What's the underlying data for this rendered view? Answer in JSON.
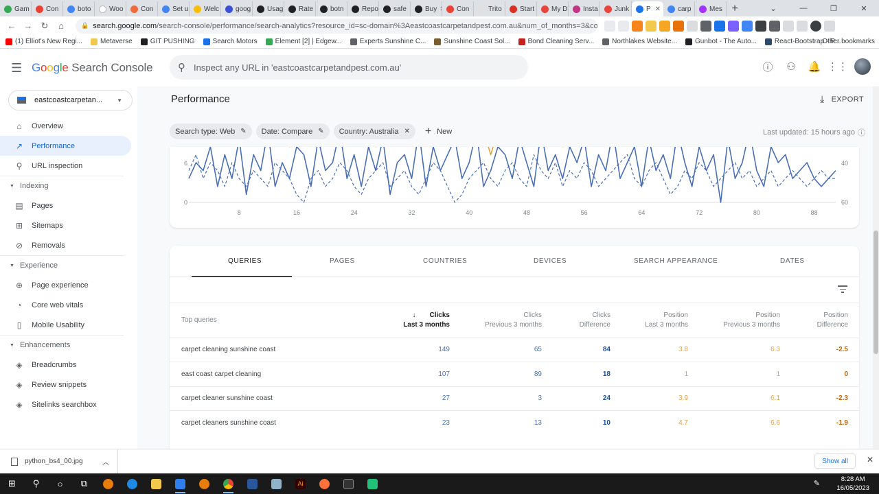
{
  "browser": {
    "tabs": [
      {
        "label": "Gam",
        "color": "#34a853"
      },
      {
        "label": "Con",
        "color": "#ea4335"
      },
      {
        "label": "boto",
        "color": "#4285f4"
      },
      {
        "label": "Woo",
        "color": "#ffffff"
      },
      {
        "label": "Con",
        "color": "#f06b3b"
      },
      {
        "label": "Set u",
        "color": "#4285f4"
      },
      {
        "label": "Welc",
        "color": "#fbbc05"
      },
      {
        "label": "goog",
        "color": "#3c4fd8"
      },
      {
        "label": "Usag",
        "color": "#202124"
      },
      {
        "label": "Rate",
        "color": "#202124"
      },
      {
        "label": "botn",
        "color": "#202124"
      },
      {
        "label": "Repo",
        "color": "#202124"
      },
      {
        "label": "safe",
        "color": "#202124"
      },
      {
        "label": "Buy",
        "color": "#202124"
      },
      {
        "label": "Con",
        "color": "#ea4335"
      },
      {
        "label": "Trito",
        "color": "#e0e0e0"
      },
      {
        "label": "Start",
        "color": "#d93025"
      },
      {
        "label": "My D",
        "color": "#e8453c"
      },
      {
        "label": "Insta",
        "color": "#c13584"
      },
      {
        "label": "Junk",
        "color": "#e8453c"
      },
      {
        "label": "P",
        "color": "#1a73e8",
        "active": true
      },
      {
        "label": "carp",
        "color": "#4285f4"
      },
      {
        "label": "Mes",
        "color": "#a033ff"
      }
    ],
    "url_host": "search.google.com",
    "url_path": "/search-console/performance/search-analytics?resource_id=sc-domain%3Aeastcoastcarpetandpest.com.au&num_of_months=3&compare_da...",
    "bookmarks": [
      {
        "label": "(1) Elliot's New Regi...",
        "color": "#ff0000"
      },
      {
        "label": "Metaverse",
        "color": "#f2c94c"
      },
      {
        "label": "GIT PUSHING",
        "color": "#202124"
      },
      {
        "label": "Search Motors",
        "color": "#1a73e8"
      },
      {
        "label": "Element [2] | Edgew...",
        "color": "#34a853"
      },
      {
        "label": "Experts Sunshine C...",
        "color": "#5f6368"
      },
      {
        "label": "Sunshine Coast Sol...",
        "color": "#7a5c2e"
      },
      {
        "label": "Bond Cleaning Serv...",
        "color": "#c5221f"
      },
      {
        "label": "Northlakes Website...",
        "color": "#5f6368"
      },
      {
        "label": "Gunbot - The Auto...",
        "color": "#202124"
      },
      {
        "label": "React-Bootstrap - R...",
        "color": "#2d4a6b"
      }
    ],
    "other_bookmarks": "Other bookmarks"
  },
  "header": {
    "logo_google": [
      "G",
      "o",
      "o",
      "g",
      "l",
      "e"
    ],
    "logo_product": "Search Console",
    "search_placeholder": "Inspect any URL in 'eastcoastcarpetandpest.com.au'"
  },
  "sidebar": {
    "property": "eastcoastcarpetan...",
    "items": [
      {
        "label": "Overview",
        "icon": "home-icon",
        "glyph": "⌂"
      },
      {
        "label": "Performance",
        "icon": "trending-icon",
        "glyph": "↗",
        "active": true
      },
      {
        "label": "URL inspection",
        "icon": "search-icon",
        "glyph": "⚲"
      }
    ],
    "sections": [
      {
        "title": "Indexing",
        "items": [
          {
            "label": "Pages",
            "icon": "pages-icon",
            "glyph": "▤"
          },
          {
            "label": "Sitemaps",
            "icon": "sitemap-icon",
            "glyph": "⊞"
          },
          {
            "label": "Removals",
            "icon": "removals-icon",
            "glyph": "⊘"
          }
        ]
      },
      {
        "title": "Experience",
        "items": [
          {
            "label": "Page experience",
            "icon": "plus-circle-icon",
            "glyph": "⊕"
          },
          {
            "label": "Core web vitals",
            "icon": "gauge-icon",
            "glyph": "◔"
          },
          {
            "label": "Mobile Usability",
            "icon": "phone-icon",
            "glyph": "▯"
          }
        ]
      },
      {
        "title": "Enhancements",
        "items": [
          {
            "label": "Breadcrumbs",
            "icon": "layers-icon",
            "glyph": "◈"
          },
          {
            "label": "Review snippets",
            "icon": "layers-icon",
            "glyph": "◈"
          },
          {
            "label": "Sitelinks searchbox",
            "icon": "layers-icon",
            "glyph": "◈"
          }
        ]
      }
    ]
  },
  "main": {
    "title": "Performance",
    "export_label": "EXPORT",
    "chips": [
      {
        "label": "Search type: Web",
        "action": "edit"
      },
      {
        "label": "Date: Compare",
        "action": "edit"
      },
      {
        "label": "Country: Australia",
        "action": "close"
      }
    ],
    "new_label": "New",
    "last_updated": "Last updated: 15 hours ago"
  },
  "chart_data": {
    "type": "line",
    "x_ticks": [
      8,
      16,
      24,
      32,
      40,
      48,
      56,
      64,
      72,
      80,
      88
    ],
    "y_left_ticks": [
      0,
      6
    ],
    "y_right_ticks": [
      60,
      40
    ],
    "y_right_inverted": true,
    "colors": {
      "clicks": "#4a6fb5",
      "position": "#e8a33d"
    },
    "series": [
      {
        "style": "solid",
        "color": "#4a6fb5",
        "values": [
          3,
          5,
          4,
          7,
          2,
          6,
          3,
          8,
          1,
          6,
          4,
          9,
          2,
          5,
          3,
          7,
          6,
          2,
          8,
          4,
          5,
          9,
          3,
          6,
          2,
          7,
          4,
          8,
          1,
          5,
          6,
          3,
          9,
          2,
          7,
          4,
          6,
          8,
          3,
          5,
          9,
          2,
          4,
          7,
          6,
          3,
          8,
          5,
          2,
          9,
          4,
          6,
          3,
          7,
          5,
          8,
          2,
          6,
          4,
          9,
          3,
          5,
          7,
          2,
          8,
          4,
          6,
          3,
          9,
          5,
          2,
          7,
          4,
          6,
          0,
          8,
          3,
          5,
          9,
          4,
          2,
          7,
          5,
          6,
          3,
          4,
          5,
          3,
          2,
          3,
          4
        ]
      },
      {
        "style": "dashed",
        "color": "#4a6fb5",
        "values": [
          4,
          6,
          3,
          5,
          4,
          2,
          5,
          3,
          2,
          4,
          3,
          2,
          5,
          4,
          3,
          1,
          0,
          3,
          4,
          2,
          3,
          5,
          4,
          2,
          1,
          3,
          4,
          5,
          2,
          3,
          4,
          2,
          1,
          3,
          5,
          4,
          2,
          0,
          1,
          3,
          4,
          5,
          3,
          2,
          4,
          5,
          3,
          2,
          6,
          4,
          3,
          5,
          2,
          4,
          3,
          5,
          4,
          2,
          3,
          4,
          5,
          6,
          3,
          2,
          4,
          5,
          3,
          1,
          2,
          4,
          3,
          5,
          4,
          2,
          3,
          4,
          5,
          3,
          4,
          2,
          3,
          4,
          2,
          3,
          4,
          3,
          2,
          3,
          4,
          3,
          3
        ]
      },
      {
        "style": "solid",
        "color": "#e8a33d",
        "values": [
          null,
          null,
          null,
          null,
          null,
          null,
          null,
          null,
          null,
          null,
          null,
          null,
          null,
          9,
          7,
          9,
          null,
          null,
          null,
          null,
          null,
          null,
          null,
          null,
          null,
          9,
          7,
          9,
          null,
          null,
          null,
          null,
          null,
          null,
          null,
          null,
          null,
          null,
          null,
          null,
          null,
          9,
          6,
          9,
          null,
          null,
          null,
          null,
          null,
          null,
          null,
          9,
          7,
          9,
          null,
          null,
          null,
          null,
          null,
          null,
          null,
          null,
          null,
          null,
          null,
          null,
          null,
          null,
          null,
          null,
          null,
          null,
          null,
          null,
          null,
          9,
          8,
          9,
          null,
          null,
          null,
          null,
          null,
          null,
          null,
          null,
          null,
          null,
          null,
          null,
          null
        ]
      }
    ]
  },
  "table": {
    "tabs": [
      "QUERIES",
      "PAGES",
      "COUNTRIES",
      "DEVICES",
      "SEARCH APPEARANCE",
      "DATES"
    ],
    "headers": {
      "query": "Top queries",
      "clicks_last": [
        "Clicks",
        "Last 3 months"
      ],
      "clicks_prev": [
        "Clicks",
        "Previous 3 months"
      ],
      "clicks_diff": [
        "Clicks",
        "Difference"
      ],
      "pos_last": [
        "Position",
        "Last 3 months"
      ],
      "pos_prev": [
        "Position",
        "Previous 3 months"
      ],
      "pos_diff": [
        "Position",
        "Difference"
      ]
    },
    "rows": [
      {
        "query": "carpet cleaning sunshine coast",
        "clicks_last": "149",
        "clicks_prev": "65",
        "clicks_diff": "84",
        "pos_last": "3.8",
        "pos_prev": "6.3",
        "pos_diff": "-2.5"
      },
      {
        "query": "east coast carpet cleaning",
        "clicks_last": "107",
        "clicks_prev": "89",
        "clicks_diff": "18",
        "pos_last": "1",
        "pos_prev": "1",
        "pos_diff": "0"
      },
      {
        "query": "carpet cleaner sunshine coast",
        "clicks_last": "27",
        "clicks_prev": "3",
        "clicks_diff": "24",
        "pos_last": "3.9",
        "pos_prev": "6.1",
        "pos_diff": "-2.3"
      },
      {
        "query": "carpet cleaners sunshine coast",
        "clicks_last": "23",
        "clicks_prev": "13",
        "clicks_diff": "10",
        "pos_last": "4.7",
        "pos_prev": "6.6",
        "pos_diff": "-1.9"
      }
    ]
  },
  "download": {
    "file": "python_bs4_00.jpg",
    "show_all": "Show all"
  },
  "taskbar": {
    "time": "8:28 AM",
    "date": "16/05/2023"
  }
}
